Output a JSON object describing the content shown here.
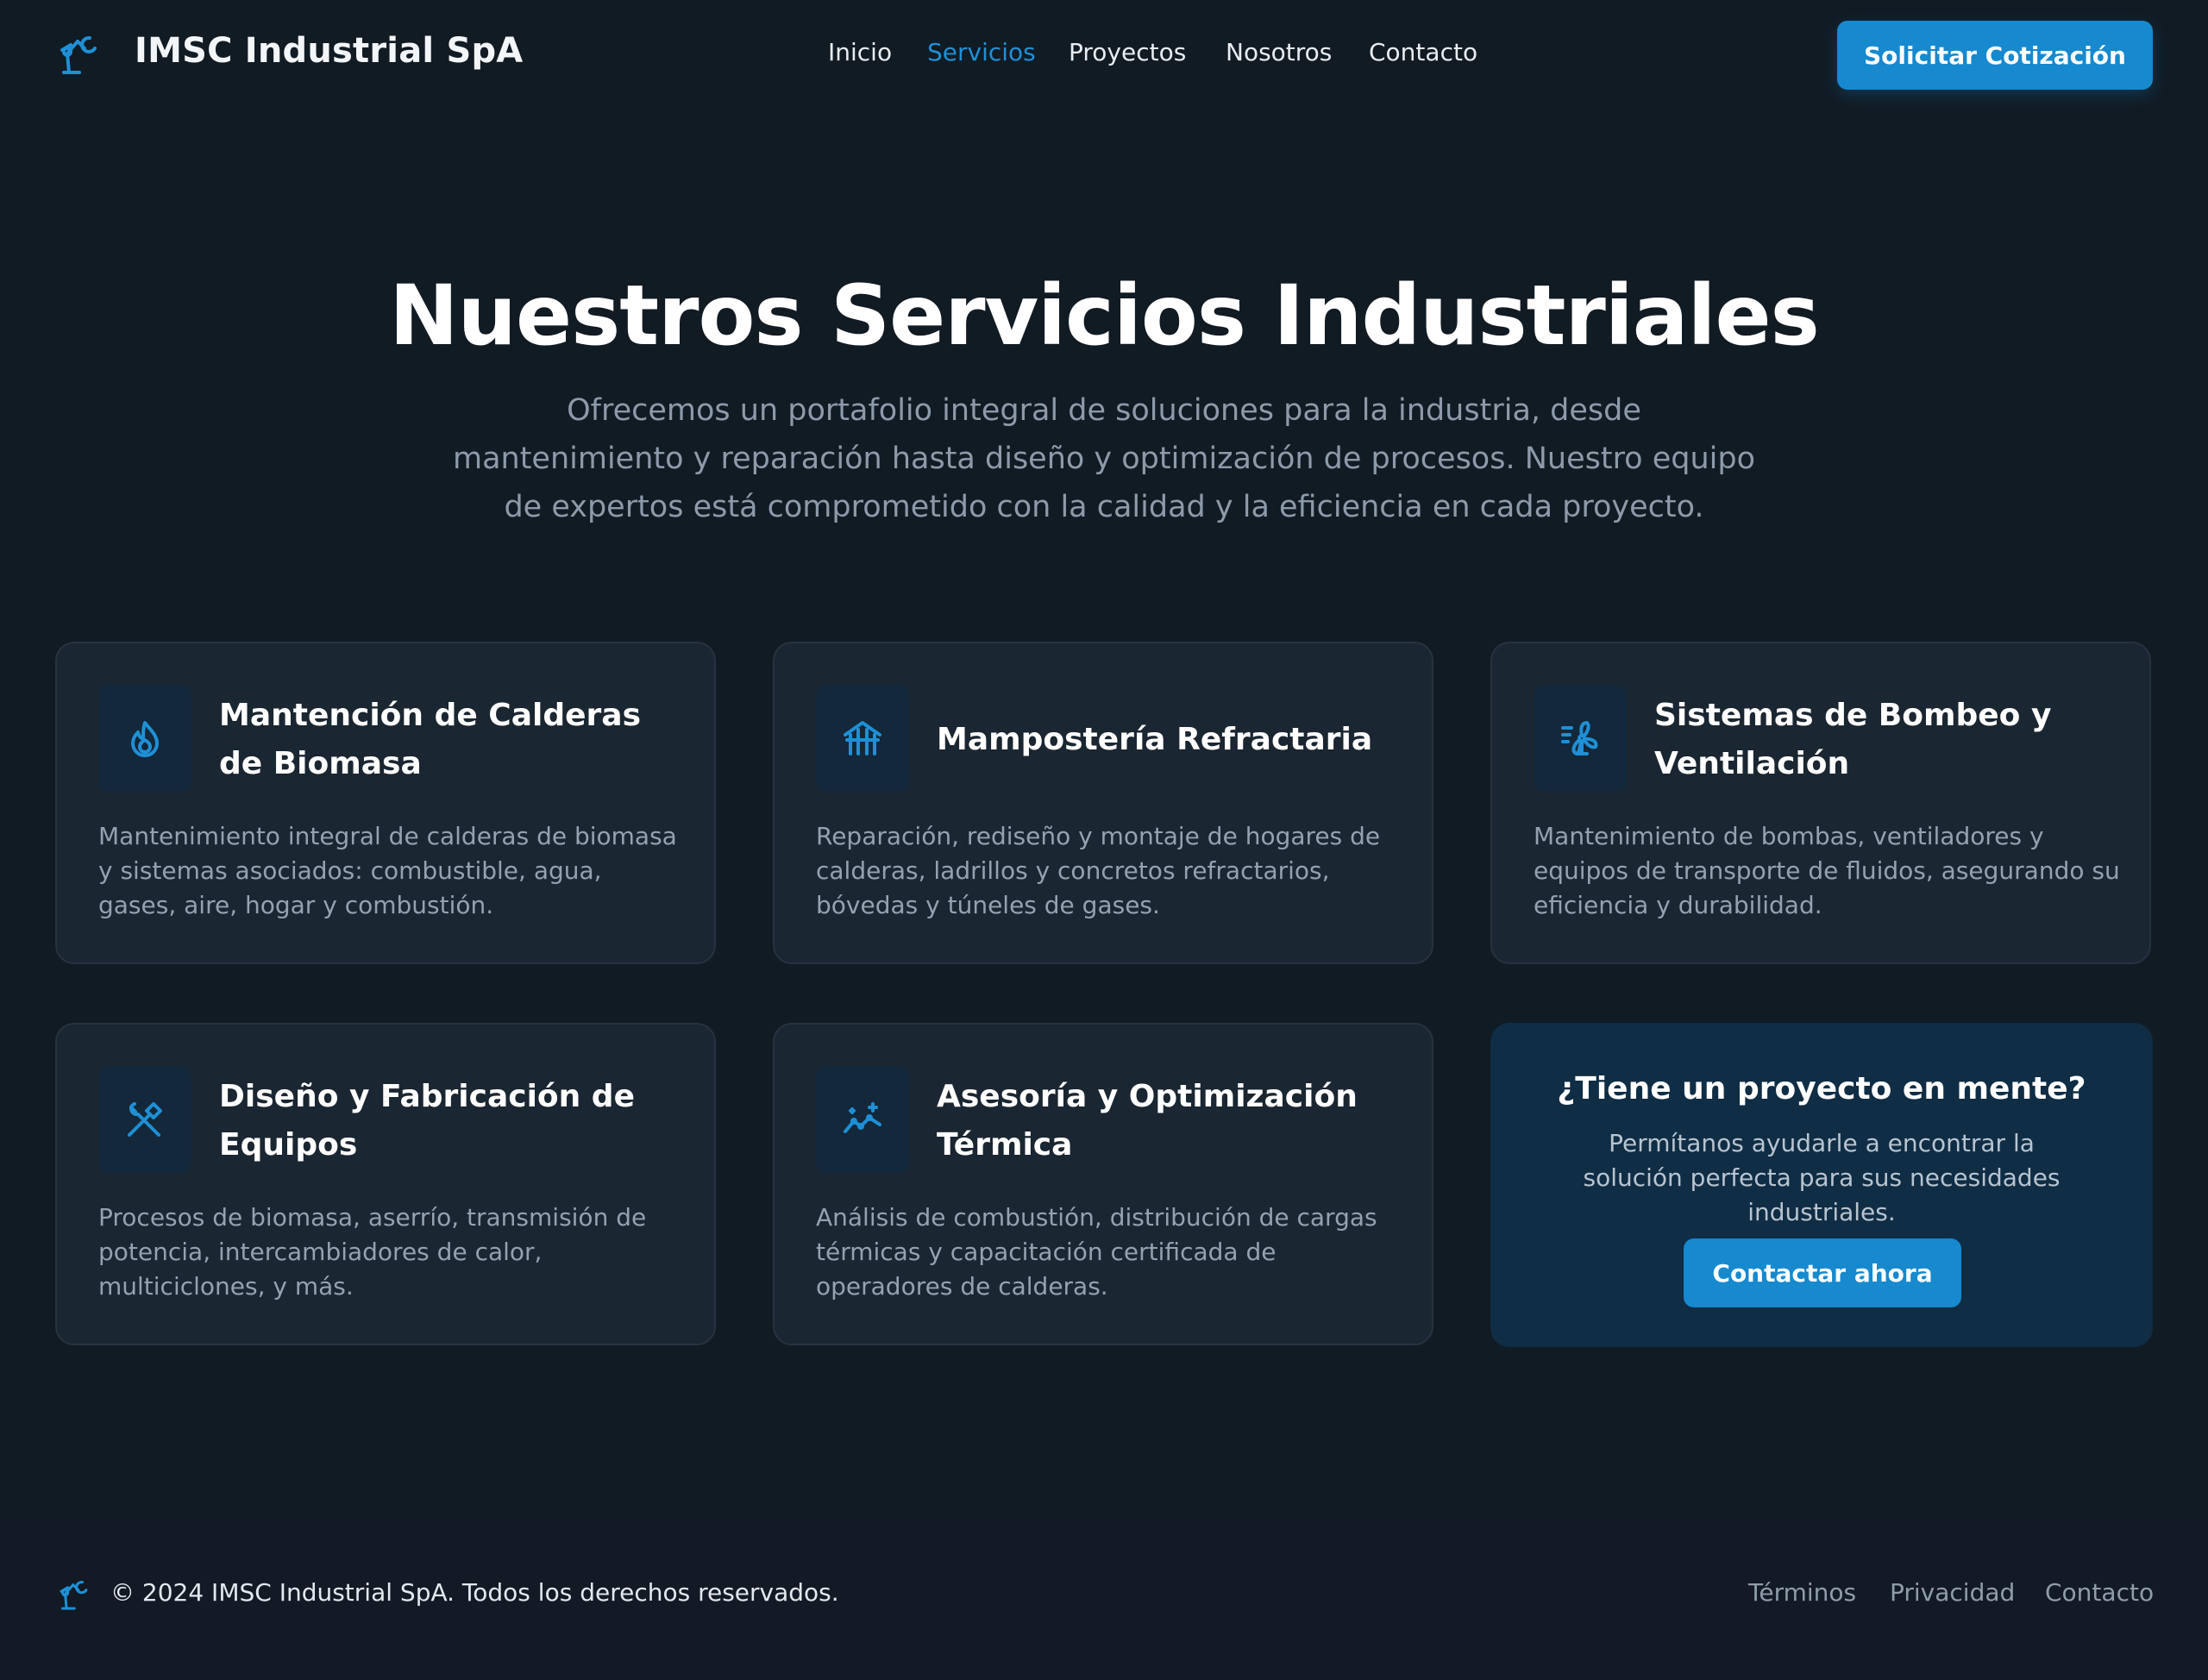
{
  "header": {
    "brand": "IMSC Industrial SpA",
    "nav": [
      {
        "label": "Inicio"
      },
      {
        "label": "Servicios",
        "active": true
      },
      {
        "label": "Proyectos"
      },
      {
        "label": "Nosotros"
      },
      {
        "label": "Contacto"
      }
    ],
    "cta_label": "Solicitar Cotización"
  },
  "hero": {
    "title": "Nuestros Servicios Industriales",
    "subtitle": "Ofrecemos un portafolio integral de soluciones para la industria, desde mantenimiento y reparación hasta diseño y optimización de procesos. Nuestro equipo de expertos está comprometido con la calidad y la eficiencia en cada proyecto."
  },
  "services": [
    {
      "icon": "flame-icon",
      "title": "Mantención de Calderas de Biomasa",
      "description": "Mantenimiento integral de calderas de biomasa y sistemas asociados: combustible, agua, gases, aire, hogar y combustión."
    },
    {
      "icon": "arch-icon",
      "title": "Mampostería Refractaria",
      "description": "Reparación, rediseño y montaje de hogares de calderas, ladrillos y concretos refractarios, bóvedas y túneles de gases."
    },
    {
      "icon": "fan-icon",
      "title": "Sistemas de Bombeo y Ventilación",
      "description": "Mantenimiento de bombas, ventiladores y equipos de transporte de fluidos, asegurando su eficiencia y durabilidad."
    },
    {
      "icon": "tools-icon",
      "title": "Diseño y Fabricación de Equipos",
      "description": "Procesos de biomasa, aserrío, transmisión de potencia, intercambiadores de calor, multiciclones, y más."
    },
    {
      "icon": "chart-sparkle-icon",
      "title": "Asesoría y Optimización Térmica",
      "description": "Análisis de combustión, distribución de cargas térmicas y capacitación certificada de operadores de calderas."
    }
  ],
  "cta_card": {
    "title": "¿Tiene un proyecto en mente?",
    "text": "Permítanos ayudarle a encontrar la solución perfecta para sus necesidades industriales.",
    "button": "Contactar ahora"
  },
  "footer": {
    "copyright": "© 2024 IMSC Industrial SpA. Todos los derechos reservados.",
    "links": [
      {
        "label": "Términos"
      },
      {
        "label": "Privacidad"
      },
      {
        "label": "Contacto"
      }
    ]
  },
  "colors": {
    "background": "#111b24",
    "accent": "#1689cf",
    "card": "#1a2631",
    "cta_card": "#0f2d45",
    "footer": "#121a26"
  }
}
